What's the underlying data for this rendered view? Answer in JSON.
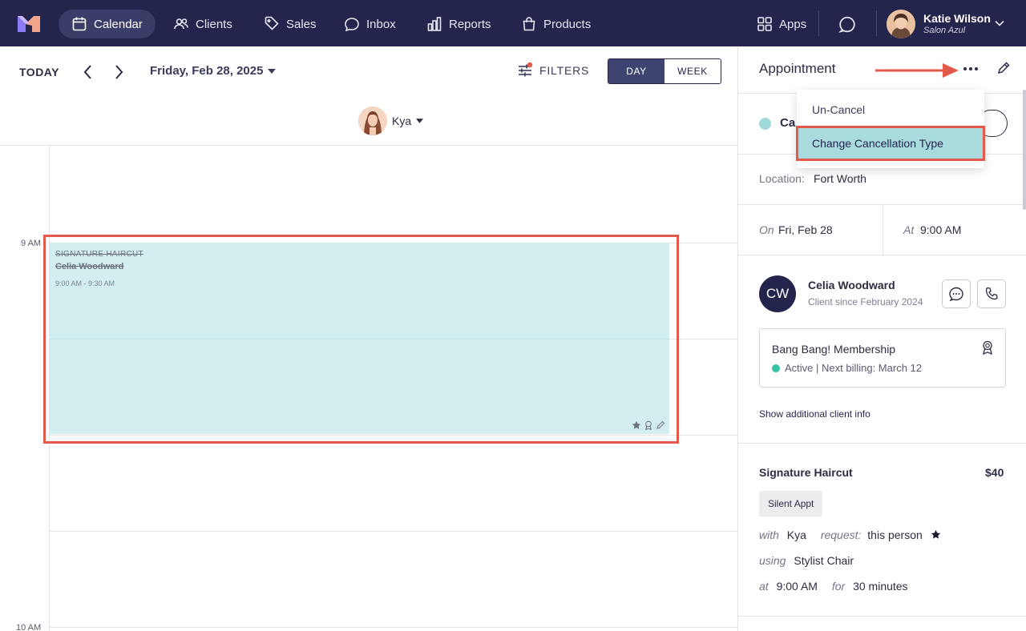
{
  "nav": {
    "items": [
      {
        "label": "Calendar",
        "icon": "calendar-icon",
        "active": true
      },
      {
        "label": "Clients",
        "icon": "users-icon"
      },
      {
        "label": "Sales",
        "icon": "tag-icon"
      },
      {
        "label": "Inbox",
        "icon": "chat-bubble-icon"
      },
      {
        "label": "Reports",
        "icon": "bar-chart-icon"
      },
      {
        "label": "Products",
        "icon": "shopping-bag-icon"
      }
    ],
    "apps_label": "Apps",
    "user_name": "Katie Wilson",
    "user_salon": "Salon Azul"
  },
  "toolbar": {
    "today": "TODAY",
    "date": "Friday, Feb 28, 2025",
    "filters": "FILTERS",
    "day": "DAY",
    "week": "WEEK",
    "staff": "Kya"
  },
  "grid": {
    "hour_9": "9 AM",
    "hour_10": "10 AM"
  },
  "appointment": {
    "service": "SIGNATURE HAIRCUT",
    "client": "Celia Woodward",
    "time": "9:00 AM - 9:30 AM"
  },
  "panel": {
    "title": "Appointment",
    "status": "Ca",
    "location_label": "Location:",
    "location": "Fort Worth",
    "on_label": "On",
    "on_value": "Fri, Feb 28",
    "at_label": "At",
    "at_value": "9:00 AM",
    "initials": "CW",
    "client_name": "Celia Woodward",
    "client_since": "Client since February 2024",
    "membership_title": "Bang Bang! Membership",
    "membership_status": "Active | Next billing: March 12",
    "show_info": "Show additional client info",
    "service_name": "Signature Haircut",
    "service_price": "$40",
    "chip": "Silent Appt",
    "with_label": "with",
    "with_value": "Kya",
    "request_label": "request:",
    "request_value": "this person",
    "using_label": "using",
    "using_value": "Stylist Chair",
    "at2_label": "at",
    "at2_value": "9:00 AM",
    "for_label": "for",
    "for_value": "30 minutes"
  },
  "dropdown": {
    "uncancel": "Un-Cancel",
    "change_type": "Change Cancellation Type"
  },
  "colors": {
    "nav_bg": "#23254c",
    "appt_bg": "#d3eeef",
    "highlight": "#e35a4c",
    "dropdown_selected": "#a9dade"
  }
}
